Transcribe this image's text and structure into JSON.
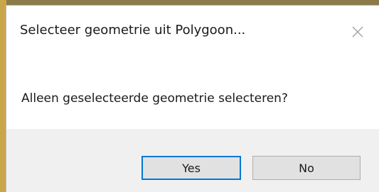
{
  "dialog": {
    "title": "Selecteer geometrie uit Polygoon...",
    "close_icon": "close-icon",
    "message": "Alleen geselecteerde geometrie selecteren?",
    "buttons": {
      "yes_label": "Yes",
      "no_label": "No"
    }
  },
  "colors": {
    "footer_background": "#f0f0f0",
    "button_background": "#e1e1e1",
    "default_button_border": "#0078d7"
  }
}
